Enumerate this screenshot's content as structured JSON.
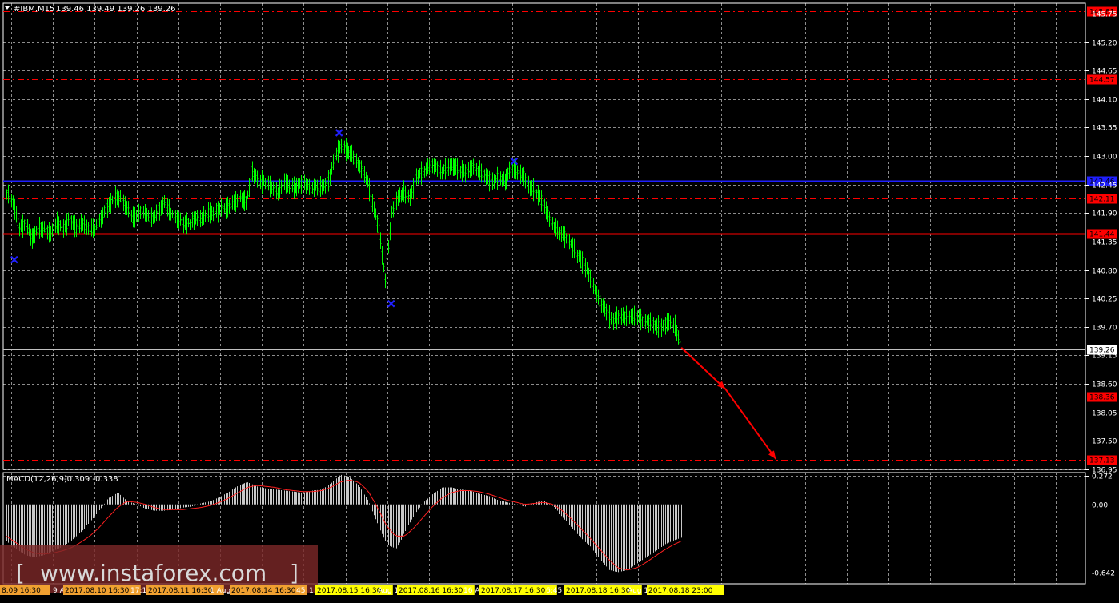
{
  "header": {
    "symbol_label": "#IBM,M15",
    "ohlc_label": "139.46 139.49 139.26 139.26"
  },
  "macd_header": {
    "label": "MACD(12,26,9)",
    "values": "-0.309 -0.338"
  },
  "watermark": {
    "open": "[",
    "text": "www.instaforex.com",
    "close": "]"
  },
  "colors": {
    "background": "#000000",
    "grid": "#ffffff",
    "candles": "#00ff00",
    "support_resistance": "#ff0000",
    "pivot_line": "#1f1fff",
    "markers": "#2020ff",
    "histogram": "#c8c8c8",
    "signal_line": "#ff2020"
  },
  "chart_data": [
    {
      "type": "line",
      "title": "#IBM,M15",
      "y_ticks": [
        "145.75",
        "145.20",
        "144.65",
        "144.10",
        "143.55",
        "143.00",
        "142.45",
        "141.90",
        "141.35",
        "140.80",
        "140.25",
        "139.70",
        "139.15",
        "138.60",
        "138.05",
        "137.50",
        "136.95"
      ],
      "ylim": [
        136.95,
        145.95
      ],
      "x_tick_labels": [
        "8.09 16:30",
        "9 A",
        "2017.08.10 16:30",
        "17:1",
        "2017.08.11 16:30",
        "1 Aug",
        "2017.08.14 16:30",
        "45",
        "1",
        "2017.08.15 16:30",
        "Aug 17",
        "2017.08.16 16:30",
        "16 A",
        "2017.08.17 16:30",
        "6:45",
        "2017.08.18 16:30",
        "Aug 1",
        "2017.08.18 23:00"
      ],
      "horizontal_levels": [
        {
          "value": 145.8,
          "label": "145.81",
          "style": "dashed",
          "color": "#ff0000"
        },
        {
          "value": 144.49,
          "label": "144.57",
          "style": "dashed",
          "color": "#ff0000"
        },
        {
          "value": 142.52,
          "label": "142.46",
          "style": "solid",
          "color": "#1f1fff"
        },
        {
          "value": 142.18,
          "label": "142.11",
          "style": "dashed",
          "color": "#ff0000"
        },
        {
          "value": 141.5,
          "label": "141.44",
          "style": "solid",
          "color": "#ff0000"
        },
        {
          "value": 138.36,
          "label": "138.36",
          "style": "dashed",
          "color": "#ff0000"
        },
        {
          "value": 137.13,
          "label": "137.13",
          "style": "dashed",
          "color": "#ff0000"
        }
      ],
      "current_price": {
        "value": 139.26,
        "label": "139.26"
      },
      "series": [
        {
          "values": [
            [
              0,
              142.3
            ],
            [
              4,
              142.1
            ],
            [
              8,
              141.6
            ],
            [
              12,
              141.7
            ],
            [
              16,
              141.4
            ],
            [
              20,
              141.6
            ],
            [
              24,
              141.6
            ],
            [
              28,
              141.5
            ],
            [
              32,
              141.7
            ],
            [
              36,
              141.6
            ],
            [
              40,
              141.8
            ],
            [
              44,
              141.6
            ],
            [
              48,
              141.7
            ],
            [
              52,
              141.6
            ],
            [
              56,
              141.6
            ],
            [
              60,
              141.8
            ],
            [
              64,
              142.0
            ],
            [
              68,
              142.2
            ],
            [
              72,
              142.2
            ],
            [
              76,
              142.0
            ],
            [
              80,
              141.8
            ],
            [
              84,
              141.9
            ],
            [
              88,
              141.9
            ],
            [
              92,
              141.8
            ],
            [
              96,
              141.9
            ],
            [
              100,
              142.1
            ],
            [
              104,
              141.9
            ],
            [
              108,
              141.8
            ],
            [
              112,
              141.7
            ],
            [
              116,
              141.7
            ],
            [
              120,
              141.8
            ],
            [
              124,
              141.8
            ],
            [
              128,
              141.9
            ],
            [
              132,
              141.9
            ],
            [
              136,
              142.0
            ],
            [
              140,
              142.0
            ],
            [
              144,
              142.1
            ],
            [
              148,
              142.2
            ],
            [
              152,
              142.1
            ],
            [
              156,
              142.7
            ],
            [
              160,
              142.5
            ],
            [
              164,
              142.5
            ],
            [
              168,
              142.4
            ],
            [
              172,
              142.3
            ],
            [
              176,
              142.5
            ],
            [
              180,
              142.4
            ],
            [
              184,
              142.4
            ],
            [
              188,
              142.5
            ],
            [
              192,
              142.4
            ],
            [
              196,
              142.4
            ],
            [
              200,
              142.4
            ],
            [
              204,
              142.5
            ],
            [
              208,
              143.0
            ],
            [
              212,
              143.2
            ],
            [
              216,
              143.1
            ],
            [
              220,
              143.0
            ],
            [
              224,
              142.8
            ],
            [
              228,
              142.6
            ],
            [
              232,
              142.1
            ],
            [
              236,
              141.6
            ],
            [
              240,
              140.6
            ],
            [
              244,
              141.9
            ],
            [
              248,
              142.2
            ],
            [
              252,
              142.3
            ],
            [
              256,
              142.2
            ],
            [
              260,
              142.6
            ],
            [
              264,
              142.7
            ],
            [
              268,
              142.8
            ],
            [
              272,
              142.8
            ],
            [
              276,
              142.7
            ],
            [
              280,
              142.8
            ],
            [
              284,
              142.8
            ],
            [
              288,
              142.7
            ],
            [
              292,
              142.7
            ],
            [
              296,
              142.8
            ],
            [
              300,
              142.7
            ],
            [
              304,
              142.6
            ],
            [
              308,
              142.5
            ],
            [
              312,
              142.6
            ],
            [
              316,
              142.5
            ],
            [
              320,
              142.8
            ],
            [
              324,
              142.7
            ],
            [
              328,
              142.6
            ],
            [
              332,
              142.4
            ],
            [
              336,
              142.3
            ],
            [
              340,
              142.1
            ],
            [
              344,
              141.8
            ],
            [
              348,
              141.6
            ],
            [
              352,
              141.5
            ],
            [
              356,
              141.4
            ],
            [
              360,
              141.2
            ],
            [
              364,
              141.0
            ],
            [
              368,
              140.8
            ],
            [
              372,
              140.5
            ],
            [
              376,
              140.2
            ],
            [
              380,
              140.0
            ],
            [
              384,
              139.8
            ],
            [
              388,
              139.9
            ],
            [
              392,
              139.9
            ],
            [
              396,
              139.9
            ],
            [
              400,
              139.9
            ],
            [
              404,
              139.8
            ],
            [
              408,
              139.8
            ],
            [
              412,
              139.7
            ],
            [
              416,
              139.7
            ],
            [
              420,
              139.8
            ],
            [
              424,
              139.7
            ],
            [
              428,
              139.3
            ]
          ]
        }
      ],
      "markers": [
        {
          "x": 5,
          "y": 141.0,
          "label": "x"
        },
        {
          "x": 211,
          "y": 143.45,
          "label": "x"
        },
        {
          "x": 244,
          "y": 140.15,
          "label": "x"
        },
        {
          "x": 322,
          "y": 142.9,
          "label": "x"
        }
      ],
      "projection": [
        [
          428,
          139.3
        ],
        [
          456,
          138.5
        ],
        [
          488,
          137.15
        ]
      ]
    },
    {
      "type": "bar",
      "title": "MACD(12,26,9)",
      "y_ticks": [
        "0.272",
        "0.00",
        "-0.642"
      ],
      "ylim": [
        -0.75,
        0.3
      ],
      "series": [
        {
          "name": "MACD",
          "values": [
            -0.35,
            -0.42,
            -0.48,
            -0.5,
            -0.48,
            -0.44,
            -0.4,
            -0.34,
            -0.26,
            -0.17,
            -0.06,
            0.06,
            0.11,
            0.03,
            0.0,
            -0.04,
            -0.06,
            -0.06,
            -0.05,
            -0.03,
            -0.02,
            0.01,
            0.03,
            0.07,
            0.12,
            0.18,
            0.21,
            0.17,
            0.15,
            0.14,
            0.13,
            0.12,
            0.11,
            0.13,
            0.14,
            0.2,
            0.28,
            0.26,
            0.18,
            0.04,
            -0.18,
            -0.38,
            -0.42,
            -0.26,
            -0.1,
            0.02,
            0.1,
            0.16,
            0.16,
            0.14,
            0.13,
            0.1,
            0.08,
            0.04,
            0.02,
            0.0,
            -0.02,
            0.02,
            0.03,
            -0.02,
            -0.12,
            -0.22,
            -0.32,
            -0.4,
            -0.52,
            -0.62,
            -0.64,
            -0.62,
            -0.56,
            -0.5,
            -0.44,
            -0.38,
            -0.34,
            -0.31
          ]
        },
        {
          "name": "Signal",
          "values": [
            -0.3,
            -0.36,
            -0.42,
            -0.46,
            -0.47,
            -0.46,
            -0.44,
            -0.41,
            -0.36,
            -0.3,
            -0.22,
            -0.12,
            -0.03,
            0.03,
            0.02,
            0.0,
            -0.03,
            -0.05,
            -0.05,
            -0.05,
            -0.04,
            -0.03,
            -0.01,
            0.02,
            0.06,
            0.11,
            0.16,
            0.18,
            0.17,
            0.16,
            0.14,
            0.13,
            0.12,
            0.12,
            0.13,
            0.16,
            0.21,
            0.23,
            0.21,
            0.13,
            -0.02,
            -0.2,
            -0.3,
            -0.3,
            -0.22,
            -0.12,
            -0.02,
            0.06,
            0.11,
            0.13,
            0.13,
            0.12,
            0.1,
            0.07,
            0.04,
            0.02,
            0.0,
            0.01,
            0.02,
            0.0,
            -0.06,
            -0.14,
            -0.23,
            -0.32,
            -0.42,
            -0.52,
            -0.6,
            -0.62,
            -0.6,
            -0.55,
            -0.49,
            -0.43,
            -0.38,
            -0.34
          ]
        }
      ]
    }
  ]
}
